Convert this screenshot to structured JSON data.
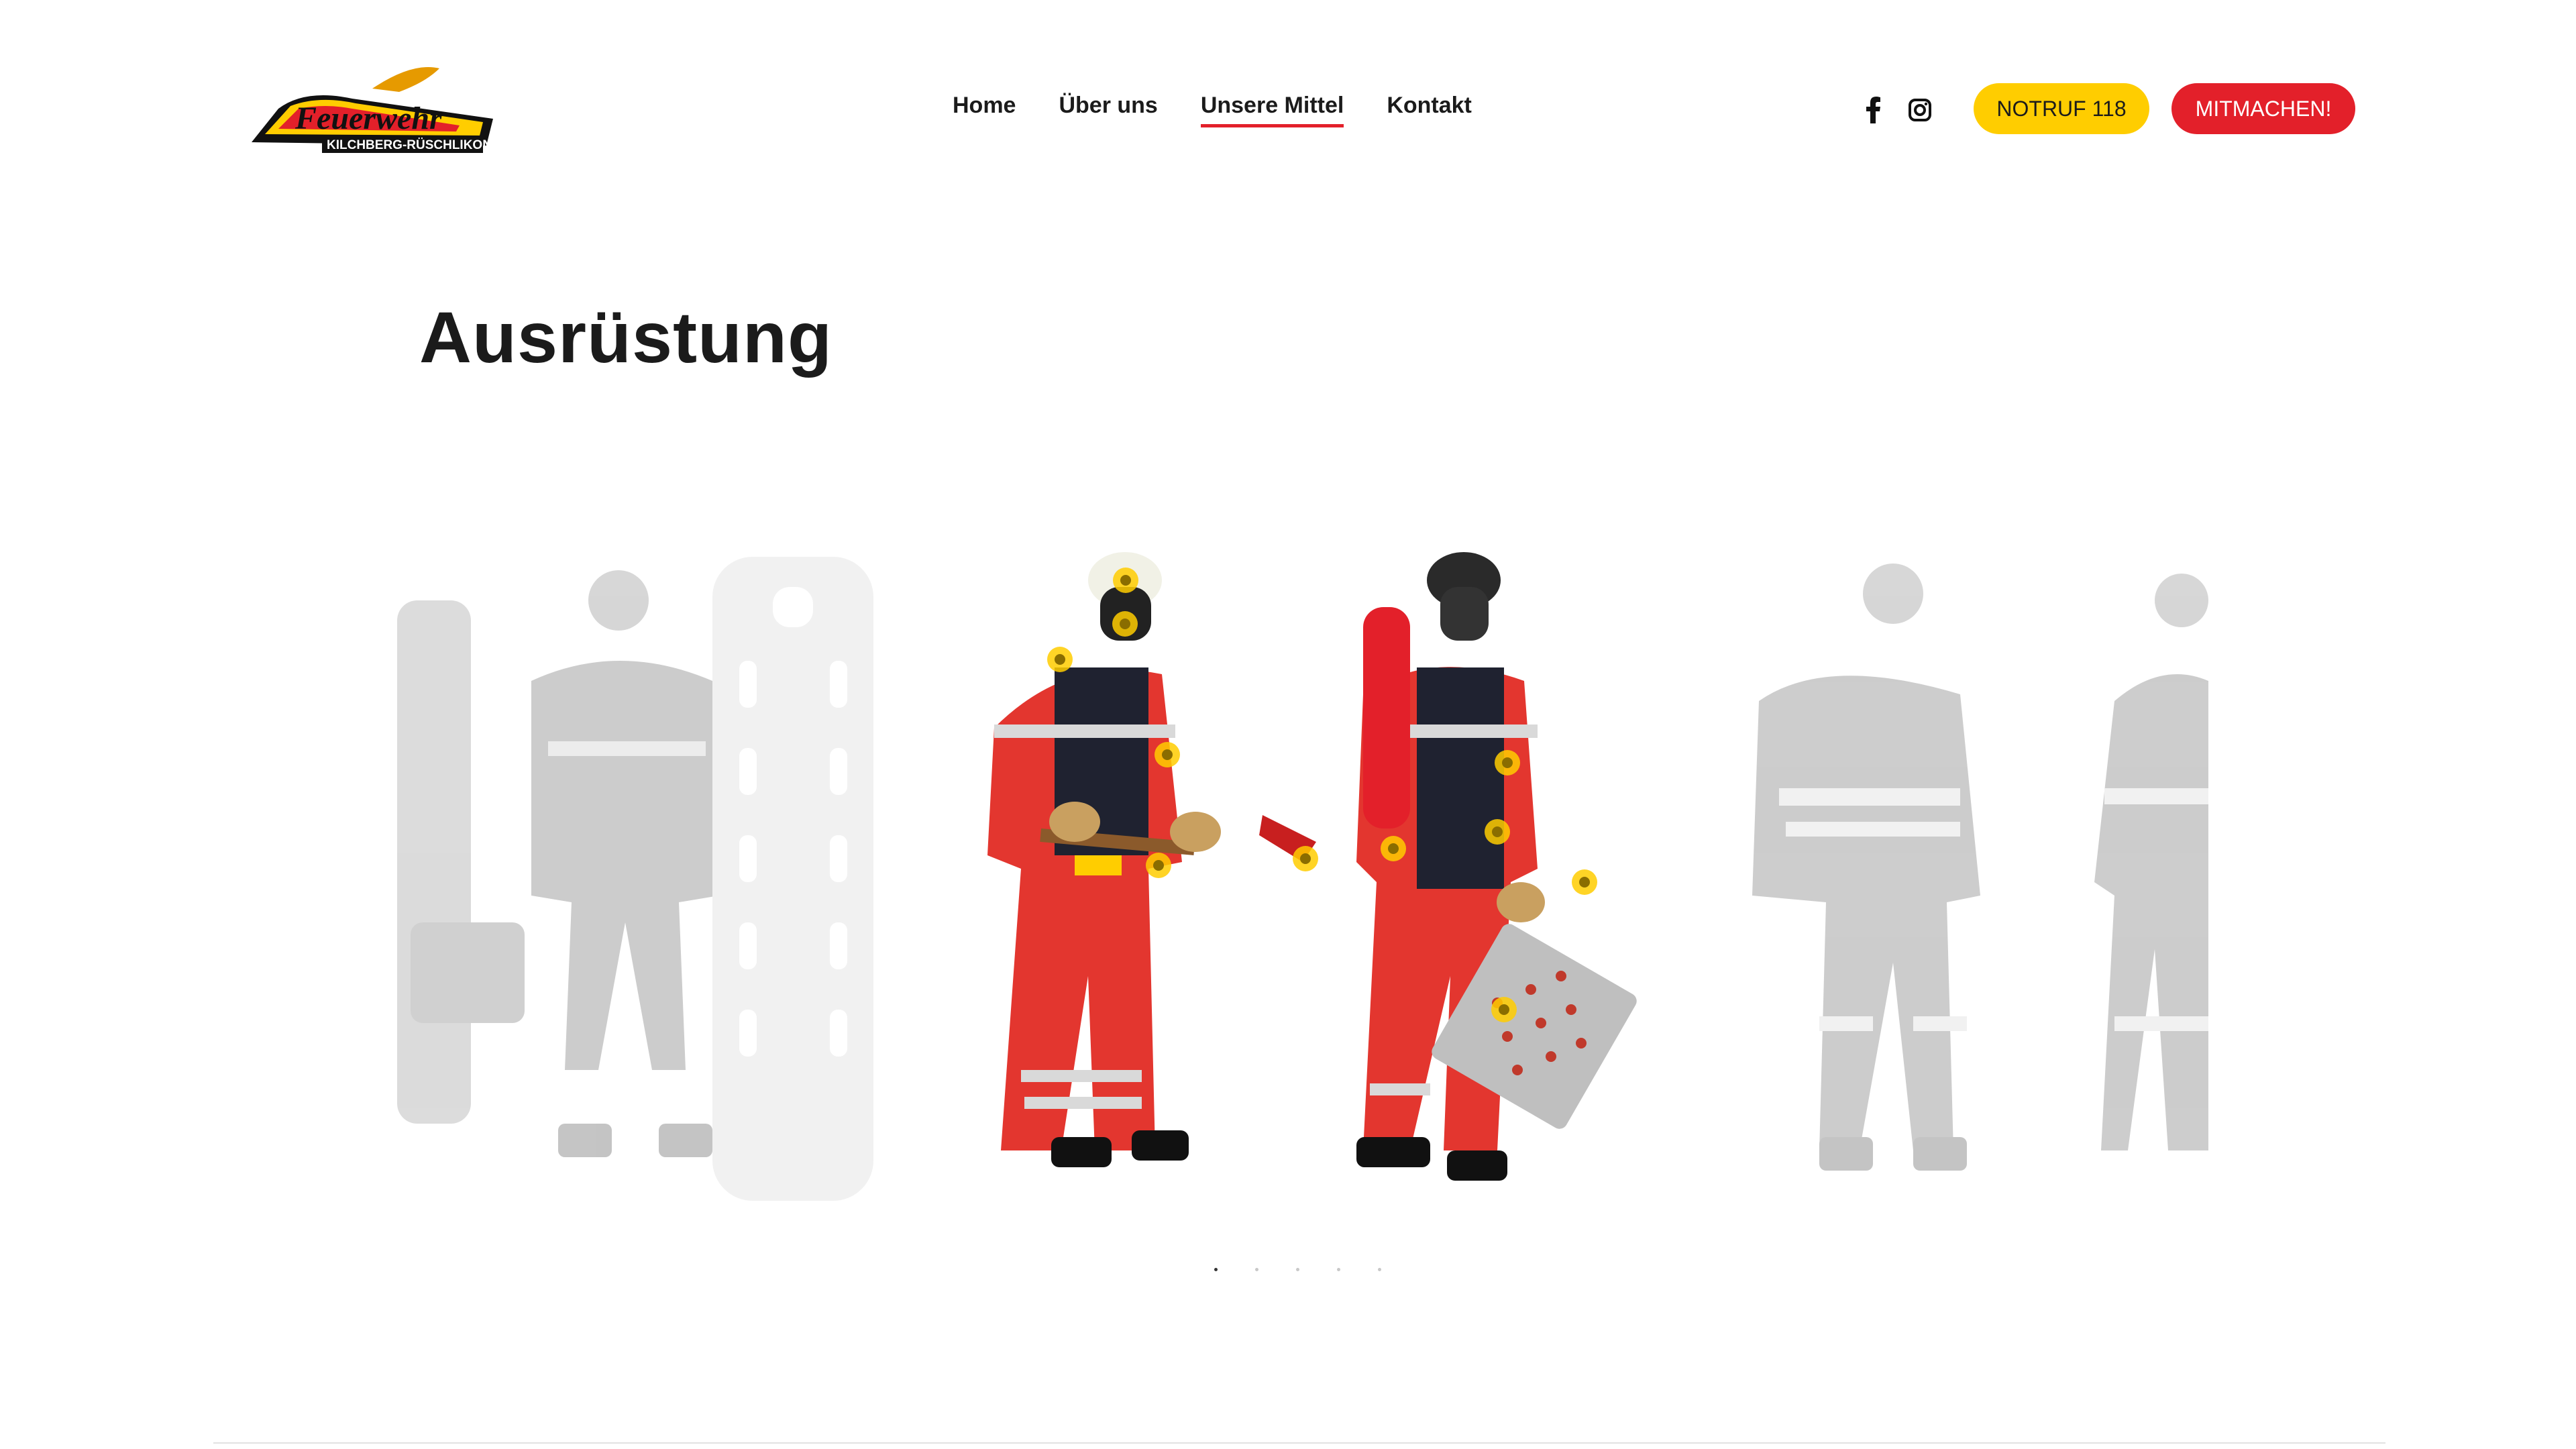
{
  "logo": {
    "wordmark": "Feuerwehr",
    "subline": "KILCHBERG-RÜSCHLIKON"
  },
  "nav": {
    "items": [
      {
        "label": "Home",
        "active": false
      },
      {
        "label": "Über uns",
        "active": false
      },
      {
        "label": "Unsere Mittel",
        "active": true
      },
      {
        "label": "Kontakt",
        "active": false
      }
    ]
  },
  "social": {
    "icons": [
      "facebook-icon",
      "instagram-icon"
    ]
  },
  "buttons": {
    "notruf": "NOTRUF 118",
    "mitmachen": "MITMACHEN!"
  },
  "page": {
    "title": "Ausrüstung"
  },
  "carousel": {
    "slide_count": 5,
    "active_index": 0
  },
  "colors": {
    "accent_red": "#e3202a",
    "accent_yellow": "#ffcd00",
    "text": "#1b1b1b"
  }
}
